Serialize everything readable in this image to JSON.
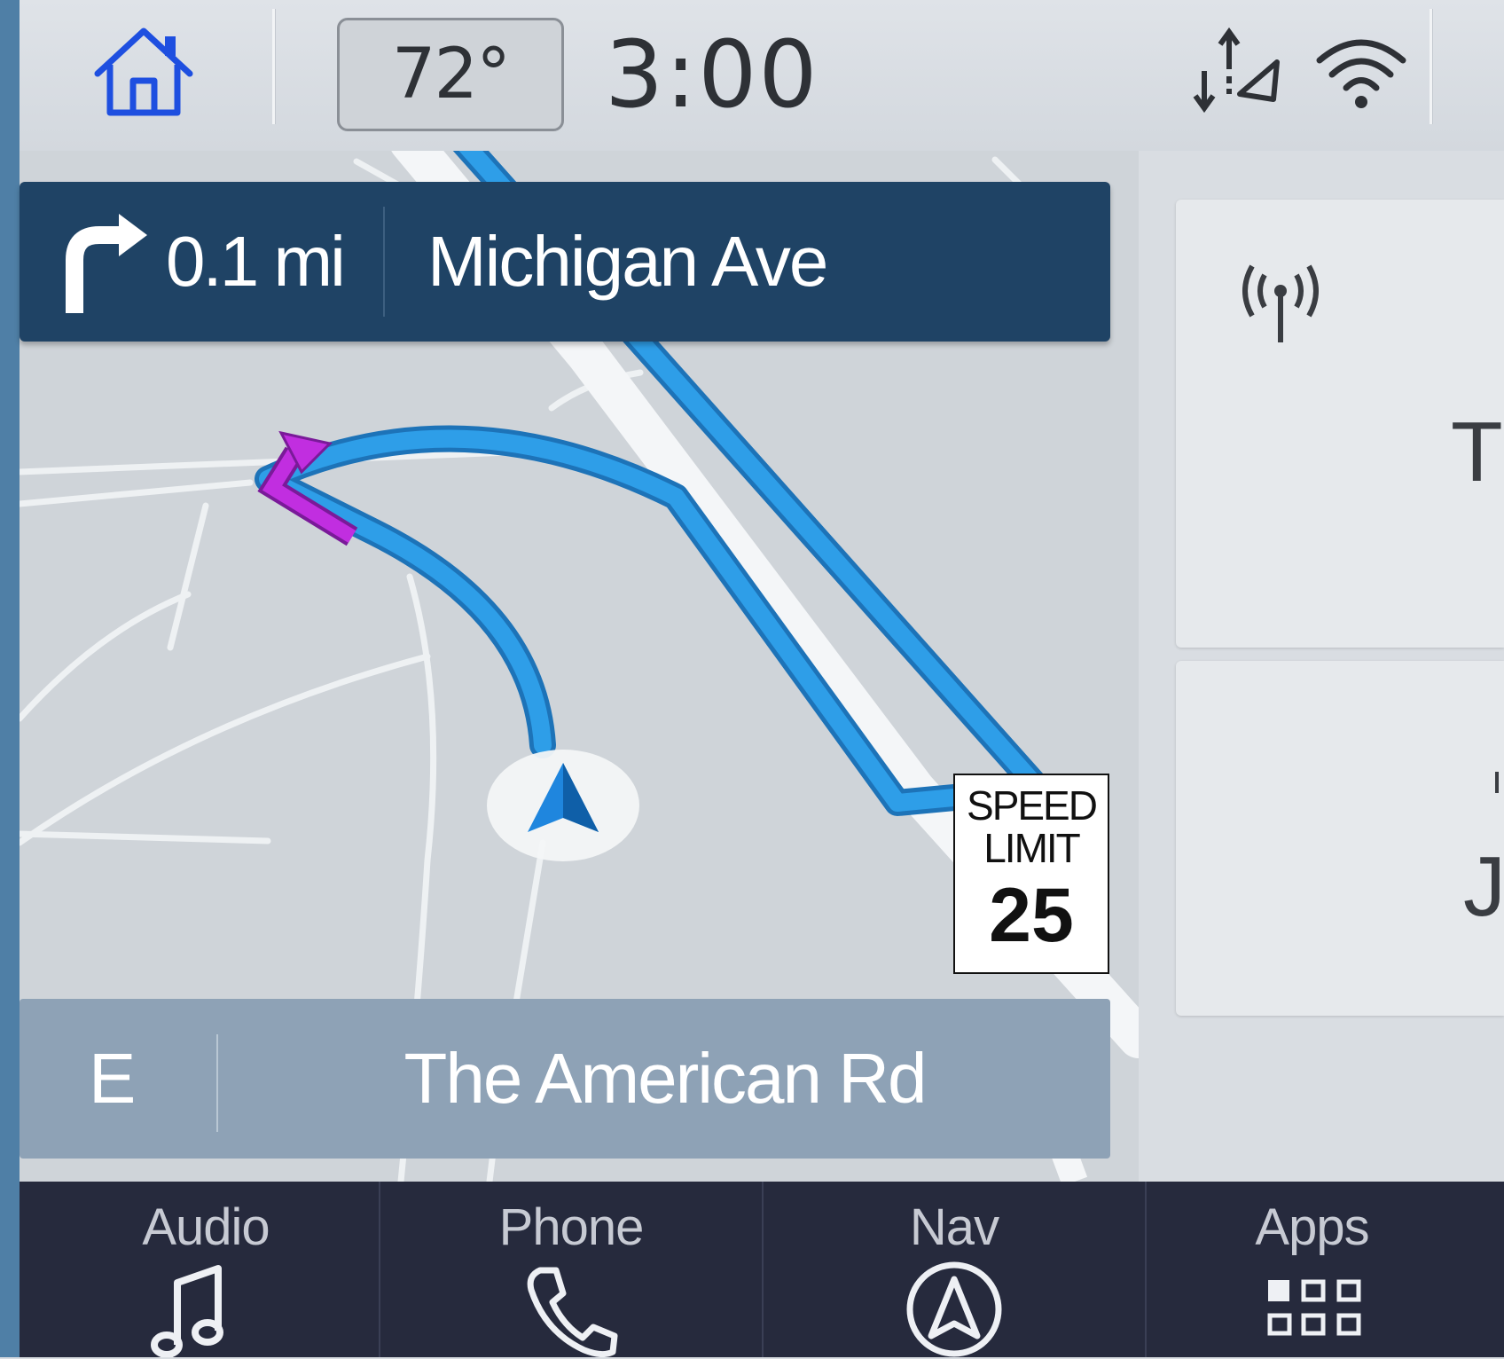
{
  "status_bar": {
    "temperature": "72°",
    "time": "3:00",
    "icons": [
      "home-icon",
      "gps-signal-icon",
      "wifi-icon"
    ]
  },
  "navigation": {
    "next_turn": {
      "direction": "right",
      "distance": "0.1 mi",
      "street": "Michigan Ave"
    },
    "heading": "E",
    "current_street": "The American Rd",
    "speed_limit": {
      "label": "SPEED LIMIT",
      "value": "25"
    }
  },
  "side_cards": [
    {
      "icon": "radio-antenna-icon",
      "text": "T"
    },
    {
      "text": "J"
    }
  ],
  "bottom_nav": [
    {
      "label": "Audio",
      "icon": "music-note-icon"
    },
    {
      "label": "Phone",
      "icon": "phone-icon"
    },
    {
      "label": "Nav",
      "icon": "navigation-icon"
    },
    {
      "label": "Apps",
      "icon": "apps-grid-icon"
    }
  ],
  "colors": {
    "accent_home": "#1e4fe0",
    "route": "#2b9be6",
    "maneuver": "#b025d6",
    "banner": "#1f4365",
    "bottom_nav": "#262a3d"
  }
}
